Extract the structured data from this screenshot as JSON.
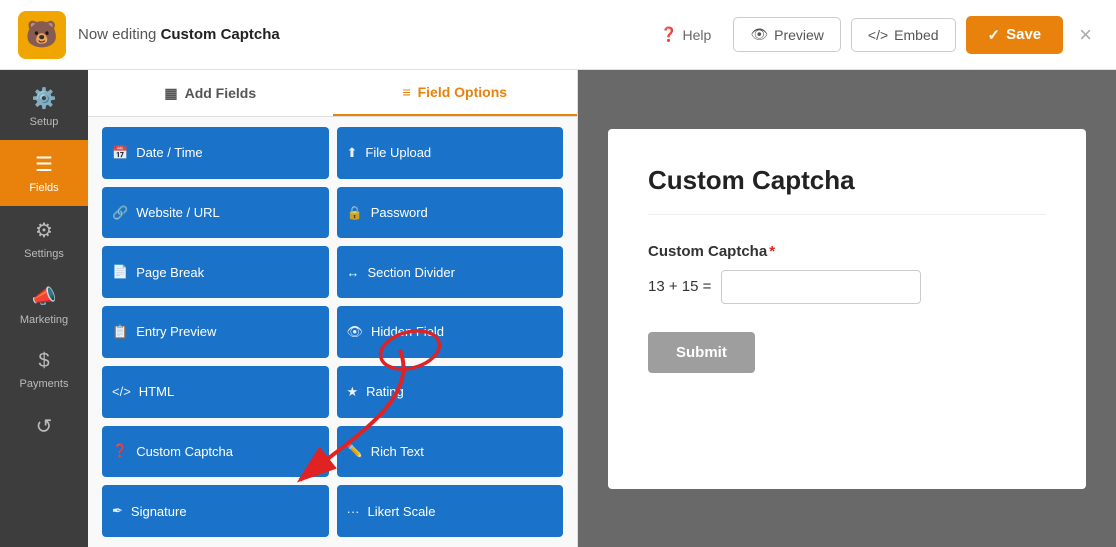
{
  "topbar": {
    "logo": "🐻",
    "editing_prefix": "Now editing",
    "form_name": "Custom Captcha",
    "help_label": "Help",
    "preview_label": "Preview",
    "embed_label": "Embed",
    "save_label": "Save",
    "close_label": "×"
  },
  "sidebar": {
    "items": [
      {
        "id": "setup",
        "label": "Setup",
        "icon": "⚙️"
      },
      {
        "id": "fields",
        "label": "Fields",
        "icon": "☰",
        "active": true
      },
      {
        "id": "settings",
        "label": "Settings",
        "icon": "⚙"
      },
      {
        "id": "marketing",
        "label": "Marketing",
        "icon": "📣"
      },
      {
        "id": "payments",
        "label": "Payments",
        "icon": "$"
      },
      {
        "id": "revisions",
        "label": "",
        "icon": "↺"
      }
    ]
  },
  "fields_panel": {
    "tabs": [
      {
        "id": "add_fields",
        "label": "Add Fields",
        "icon": "▦",
        "active": false
      },
      {
        "id": "field_options",
        "label": "Field Options",
        "icon": "≡",
        "active": true
      }
    ],
    "field_buttons": [
      {
        "id": "date_time",
        "label": "Date / Time",
        "icon": "📅"
      },
      {
        "id": "file_upload",
        "label": "File Upload",
        "icon": "⬆"
      },
      {
        "id": "website_url",
        "label": "Website / URL",
        "icon": "🔗"
      },
      {
        "id": "password",
        "label": "Password",
        "icon": "🔒"
      },
      {
        "id": "page_break",
        "label": "Page Break",
        "icon": "📄"
      },
      {
        "id": "section_divider",
        "label": "Section Divider",
        "icon": "↔"
      },
      {
        "id": "entry_preview",
        "label": "Entry Preview",
        "icon": "📋"
      },
      {
        "id": "hidden_field",
        "label": "Hidden Field",
        "icon": "👁"
      },
      {
        "id": "html",
        "label": "HTML",
        "icon": "</>"
      },
      {
        "id": "rating",
        "label": "Rating",
        "icon": "★"
      },
      {
        "id": "custom_captcha",
        "label": "Custom Captcha",
        "icon": "❓"
      },
      {
        "id": "rich_text",
        "label": "Rich Text",
        "icon": "✏️"
      },
      {
        "id": "signature",
        "label": "Signature",
        "icon": "✒"
      },
      {
        "id": "likert_scale",
        "label": "Likert Scale",
        "icon": "···"
      }
    ]
  },
  "preview": {
    "form_title": "Custom Captcha",
    "field_label": "Custom Captcha",
    "captcha_expression": "13 + 15 =",
    "captcha_placeholder": "",
    "submit_label": "Submit"
  }
}
